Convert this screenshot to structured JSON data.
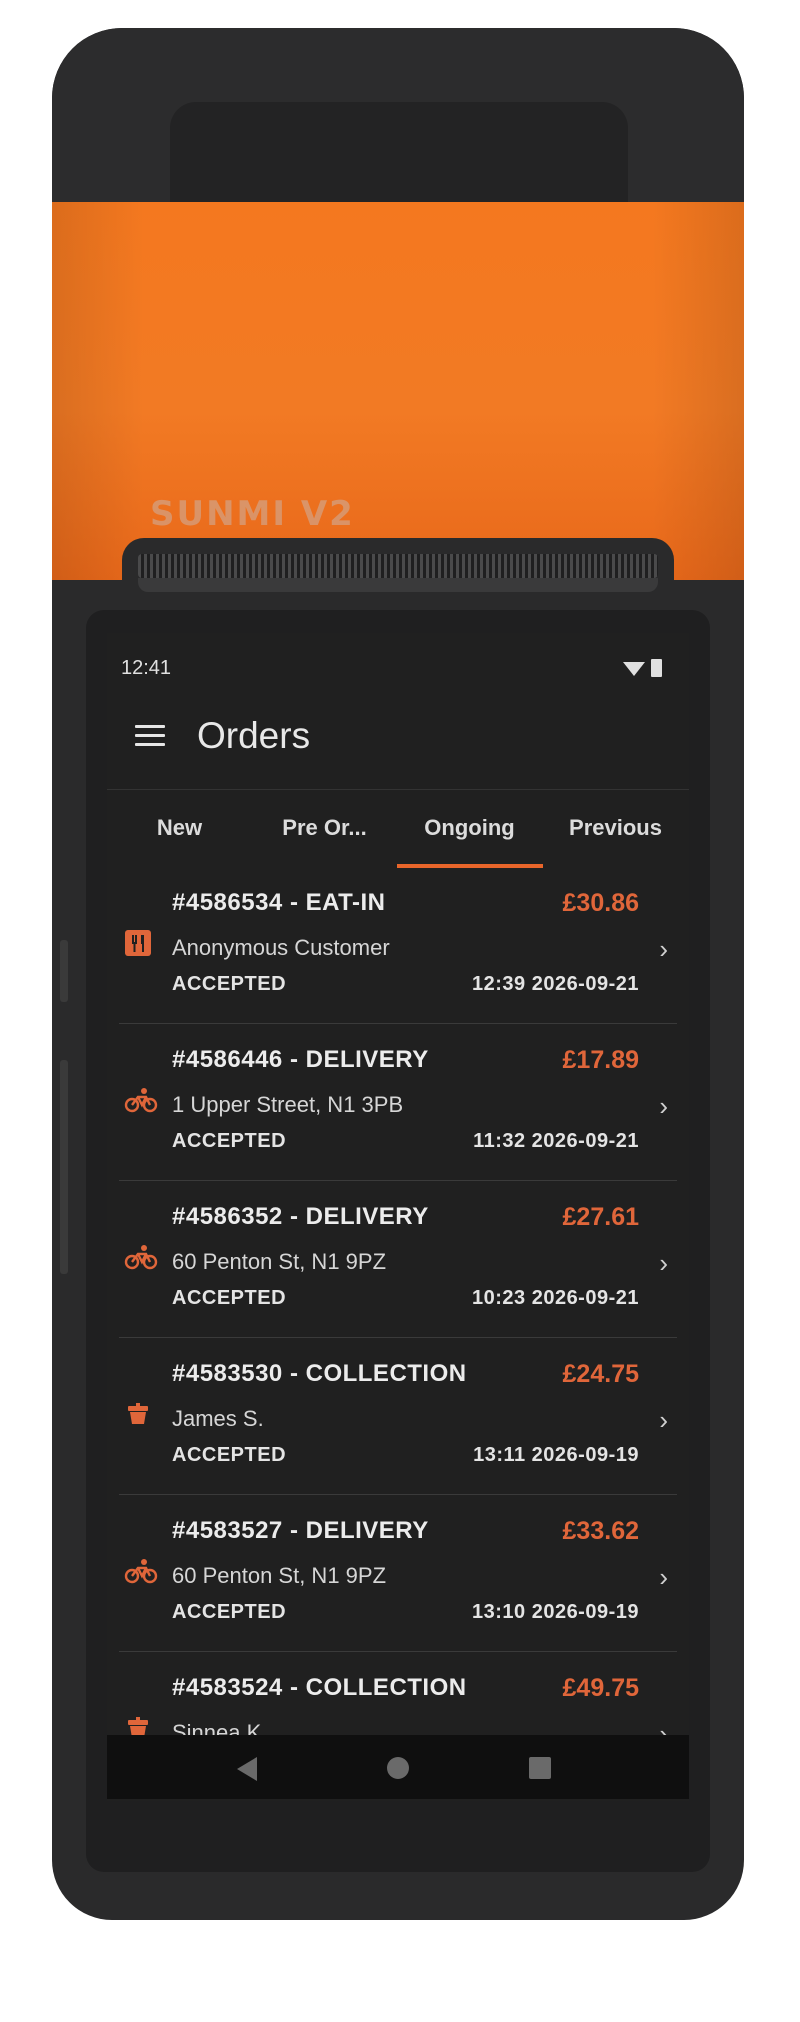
{
  "device": {
    "brand": "SUNMI V2"
  },
  "status_bar": {
    "time": "12:41"
  },
  "app_bar": {
    "title": "Orders"
  },
  "tabs": [
    {
      "label": "New"
    },
    {
      "label": "Pre Or..."
    },
    {
      "label": "Ongoing",
      "selected": true
    },
    {
      "label": "Previous"
    }
  ],
  "orders": [
    {
      "title": "#4586534 - EAT-IN",
      "price": "£30.86",
      "subtitle": "Anonymous Customer",
      "status": "ACCEPTED",
      "datetime": "12:39  2026-09-21",
      "icon": "eat-in-icon"
    },
    {
      "title": "#4586446 - DELIVERY",
      "price": "£17.89",
      "subtitle": "1 Upper Street, N1 3PB",
      "status": "ACCEPTED",
      "datetime": "11:32  2026-09-21",
      "icon": "bicycle-icon"
    },
    {
      "title": "#4586352 - DELIVERY",
      "price": "£27.61",
      "subtitle": "60 Penton St, N1 9PZ",
      "status": "ACCEPTED",
      "datetime": "10:23  2026-09-21",
      "icon": "bicycle-icon"
    },
    {
      "title": "#4583530 - COLLECTION",
      "price": "£24.75",
      "subtitle": "James S.",
      "status": "ACCEPTED",
      "datetime": "13:11  2026-09-19",
      "icon": "collection-icon"
    },
    {
      "title": "#4583527 - DELIVERY",
      "price": "£33.62",
      "subtitle": "60 Penton St, N1 9PZ",
      "status": "ACCEPTED",
      "datetime": "13:10  2026-09-19",
      "icon": "bicycle-icon"
    },
    {
      "title": "#4583524 - COLLECTION",
      "price": "£49.75",
      "subtitle": "Sinnea K.",
      "status": "",
      "datetime": "",
      "icon": "collection-icon"
    }
  ],
  "colors": {
    "accent": "#e8652a",
    "background": "#202020",
    "device_orange": "#f4781f"
  }
}
